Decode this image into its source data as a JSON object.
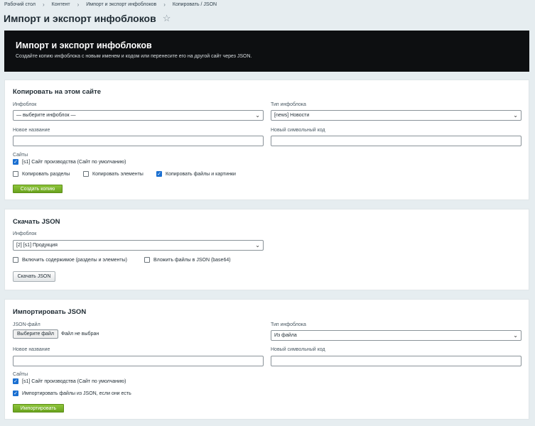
{
  "breadcrumbs": [
    "Рабочий стол",
    "Контент",
    "Импорт и экспорт инфоблоков",
    "Копировать / JSON"
  ],
  "page_title": "Импорт и экспорт инфоблоков",
  "banner": {
    "title": "Импорт и экспорт инфоблоков",
    "description": "Создайте копию инфоблока с новым именем и кодом или перенесите его на другой сайт через JSON."
  },
  "copy_section": {
    "title": "Копировать на этом сайте",
    "iblock_label": "Инфоблок",
    "iblock_value": "— выберите инфоблок —",
    "type_label": "Тип инфоблока",
    "type_value": "[news] Новости",
    "name_label": "Новое название",
    "name_value": "",
    "code_label": "Новый символьный код",
    "code_value": "",
    "sites_label": "Сайты",
    "site_option": "[s1] Сайт производства (Сайт по умолчанию)",
    "copy_sections_label": "Копировать разделы",
    "copy_elements_label": "Копировать элементы",
    "copy_files_label": "Копировать файлы и картинки",
    "submit_label": "Создать копию"
  },
  "download_section": {
    "title": "Скачать JSON",
    "iblock_label": "Инфоблок",
    "iblock_value": "[2] [s1] Продукция",
    "include_content_label": "Включить содержимое (разделы и элементы)",
    "embed_files_label": "Вложить файлы в JSON (base64)",
    "submit_label": "Скачать JSON"
  },
  "import_section": {
    "title": "Импортировать JSON",
    "file_label": "JSON-файл",
    "file_button": "Выберите файл",
    "file_status": "Файл не выбран",
    "type_label": "Тип инфоблока",
    "type_value": "Из файла",
    "name_label": "Новое название",
    "name_value": "",
    "code_label": "Новый символьный код",
    "code_value": "",
    "sites_label": "Сайты",
    "site_option": "[s1] Сайт производства (Сайт по умолчанию)",
    "import_files_label": "Импортировать файлы из JSON, если они есть",
    "submit_label": "Импортировать"
  },
  "colors": {
    "accent_green": "#7ab52a",
    "banner_bg": "#0d0f11",
    "checkbox_blue": "#1a6fd1"
  },
  "icons": {
    "favorite": "star-outline",
    "breadcrumb_separator": "chevron-right",
    "select_arrow": "chevron-down"
  }
}
